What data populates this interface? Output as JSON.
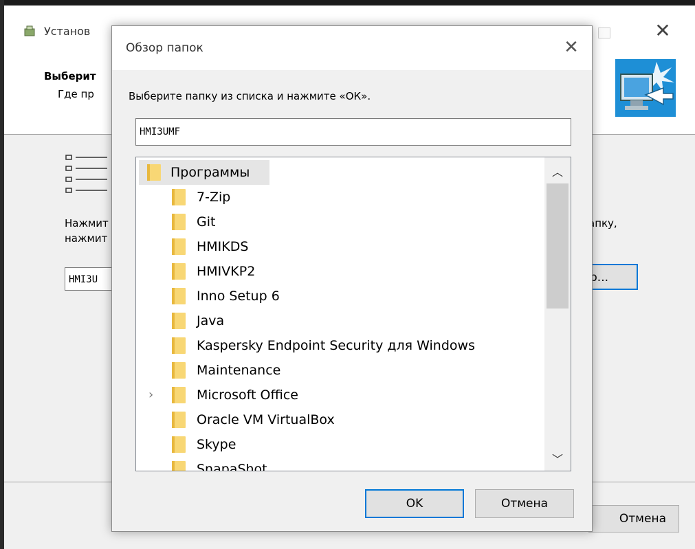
{
  "installer": {
    "title": "Установ",
    "heading": "Выберит",
    "subheading": "Где пр",
    "text_line1": "Нажмит",
    "text_line2": "нажмит",
    "right_text": "апку,",
    "path_value": "HMI3U",
    "browse_label": "р...",
    "cancel_label": "Отмена"
  },
  "dialog": {
    "title": "Обзор папок",
    "prompt": "Выберите папку из списка и нажмите «ОК».",
    "folder_input_value": "HMI3UMF",
    "root_folder": "Программы",
    "folders": [
      "7-Zip",
      "Git",
      "HMIKDS",
      "HMIVKP2",
      "Inno Setup 6",
      "Java",
      "Kaspersky Endpoint Security для Windows",
      "Maintenance",
      "Microsoft Office",
      "Oracle VM VirtualBox",
      "Skype",
      "SnapaShot"
    ],
    "ok_label": "OK",
    "cancel_label": "Отмена"
  }
}
